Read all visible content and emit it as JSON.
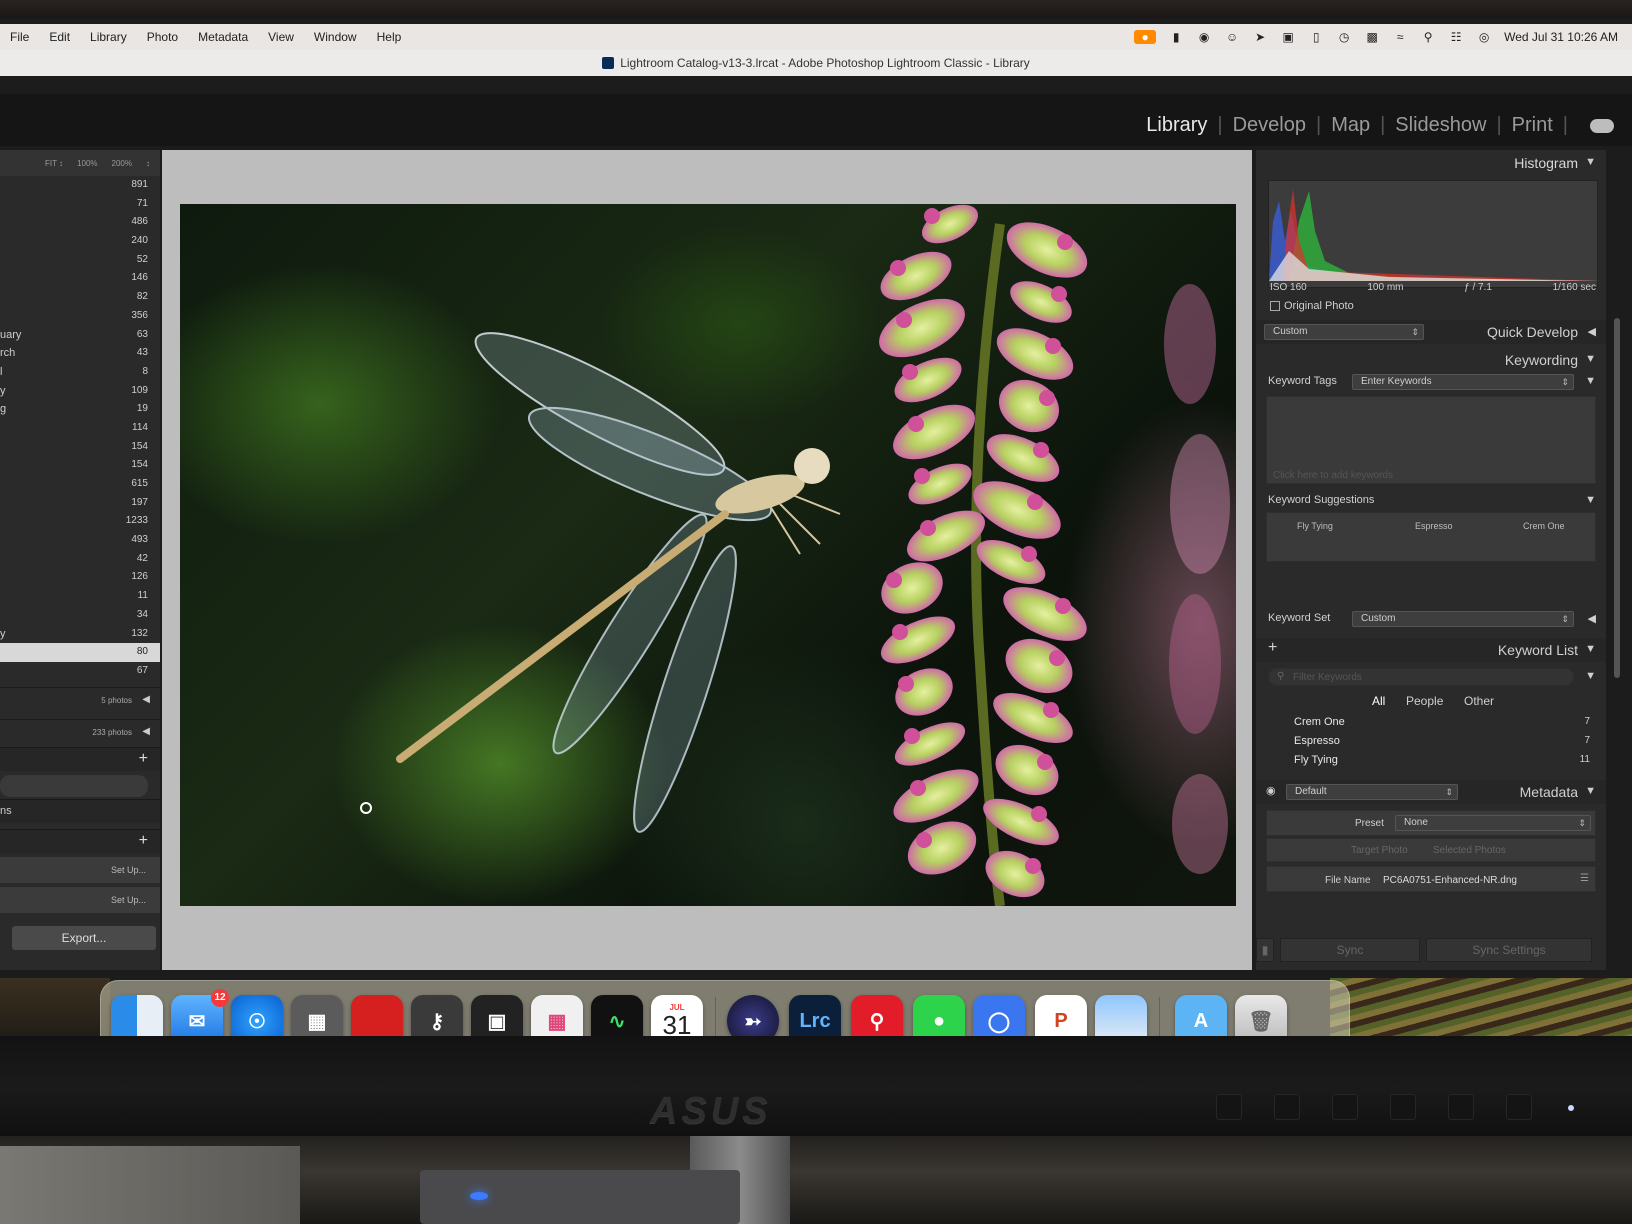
{
  "menubar": {
    "apple": "",
    "items": [
      "File",
      "Edit",
      "Library",
      "Photo",
      "Metadata",
      "View",
      "Window",
      "Help"
    ],
    "clock": "Wed Jul 31  10:26 AM"
  },
  "window": {
    "title": "Lightroom Catalog-v13-3.lrcat - Adobe Photoshop Lightroom Classic - Library"
  },
  "modules": {
    "items": [
      "Library",
      "Develop",
      "Map",
      "Slideshow",
      "Print"
    ],
    "active": "Library"
  },
  "left_panel": {
    "zoom": [
      "FIT ↕",
      "100%",
      "200%",
      "↕"
    ],
    "rows": [
      {
        "label": "",
        "count": "891"
      },
      {
        "label": "",
        "count": "71"
      },
      {
        "label": "",
        "count": "486"
      },
      {
        "label": "",
        "count": "240"
      },
      {
        "label": "",
        "count": "52"
      },
      {
        "label": "",
        "count": "146"
      },
      {
        "label": "",
        "count": "82"
      },
      {
        "label": "",
        "count": "356"
      },
      {
        "label": "uary",
        "count": "63"
      },
      {
        "label": "rch",
        "count": "43"
      },
      {
        "label": "l",
        "count": "8"
      },
      {
        "label": "y",
        "count": "109"
      },
      {
        "label": "g",
        "count": "19"
      },
      {
        "label": "",
        "count": "114"
      },
      {
        "label": "",
        "count": "154"
      },
      {
        "label": "",
        "count": "154"
      },
      {
        "label": "",
        "count": "615"
      },
      {
        "label": "",
        "count": "197"
      },
      {
        "label": "",
        "count": "1233"
      },
      {
        "label": "",
        "count": "493"
      },
      {
        "label": "",
        "count": "42"
      },
      {
        "label": "",
        "count": "126"
      },
      {
        "label": "",
        "count": "11"
      },
      {
        "label": "",
        "count": "34"
      },
      {
        "label": "y",
        "count": "132"
      },
      {
        "label": "",
        "count": "80"
      },
      {
        "label": "",
        "count": "67"
      }
    ],
    "selected_index": 25,
    "smart_rows": [
      {
        "count": "5 photos"
      },
      {
        "count": "233 photos"
      }
    ],
    "section_label": "ns",
    "setup_labels": [
      "Set Up...",
      "Set Up..."
    ],
    "export_label": "Export..."
  },
  "right_panel": {
    "histogram_title": "Histogram",
    "histogram_info": [
      "ISO 160",
      "100 mm",
      "ƒ / 7.1",
      "1/160 sec"
    ],
    "original_photo": "Original Photo",
    "quick_develop": {
      "preset": "Custom",
      "title": "Quick Develop"
    },
    "keywording": {
      "title": "Keywording",
      "tags_label": "Keyword Tags",
      "tags_value": "Enter Keywords",
      "click_hint": "Click here to add keywords",
      "suggestions_title": "Keyword Suggestions",
      "suggestions": [
        "Fly Tying",
        "Espresso",
        "Crem One"
      ],
      "set_label": "Keyword Set",
      "set_value": "Custom"
    },
    "keyword_list": {
      "title": "Keyword List",
      "filter_placeholder": "Filter Keywords",
      "tabs": [
        "All",
        "People",
        "Other"
      ],
      "items": [
        {
          "name": "Crem One",
          "count": "7"
        },
        {
          "name": "Espresso",
          "count": "7"
        },
        {
          "name": "Fly Tying",
          "count": "11"
        }
      ]
    },
    "metadata": {
      "preset_dropdown": "Default",
      "title": "Metadata",
      "preset_label": "Preset",
      "preset_value": "None",
      "target_photo": "Target Photo",
      "selected_photos": "Selected Photos",
      "file_name_label": "File Name",
      "file_name_value": "PC6A0751-Enhanced-NR.dng"
    },
    "sync_label": "Sync",
    "sync_settings_label": "Sync Settings"
  },
  "dock": {
    "mail_badge": "12",
    "calendar": {
      "month": "JUL",
      "day": "31"
    },
    "lrc_label": "Lrc",
    "apps": [
      "finder-icon",
      "mail-icon",
      "safari-icon",
      "calculator-icon",
      "red-app-icon",
      "keychain-icon",
      "mission-control-icon",
      "launchpad-icon",
      "activity-monitor-icon",
      "calendar-icon",
      "lightroom-icon",
      "lightroom-classic-icon",
      "quicktime-icon",
      "messages-icon",
      "signal-icon",
      "powerpoint-icon",
      "preview-icon",
      "applications-folder-icon",
      "trash-icon"
    ]
  },
  "monitor": {
    "brand": "ASUS"
  }
}
